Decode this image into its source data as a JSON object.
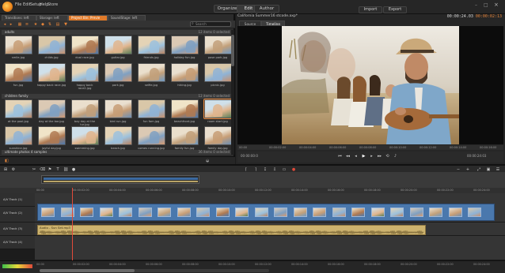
{
  "menu": [
    "File",
    "Edit",
    "Setup",
    "Help",
    "Store"
  ],
  "modes": {
    "organize": "Organize",
    "edit": "Edit",
    "author": "Author"
  },
  "io": {
    "import": "Import",
    "export": "Export"
  },
  "library": {
    "tabs": [
      "Transitions: Ieft",
      "Storage: left",
      "Project Bin: Previe",
      "SoundStage: Ieft"
    ],
    "search_placeholder": "Search",
    "sections": [
      {
        "title": "adults",
        "count": "12 items 0 selected"
      },
      {
        "title": "children family",
        "count": "12 items 0 selected"
      },
      {
        "title": "ultimate photos 4 samples",
        "count": "36 items 0 selected"
      }
    ],
    "row1": [
      "smile.jpg",
      "childs.jpg",
      "dual race.jpg",
      "guitar.jpg",
      "friends.jpg",
      "holiday fun.jpg",
      "pose park.jpg"
    ],
    "row2": [
      "fun.jpg",
      "happy back race.jpg",
      "happy back race2.jpg",
      "park.jpg",
      "selfie.jpg",
      "hiking.jpg",
      "picnic.jpg"
    ],
    "row3": [
      "at the pool.jpg",
      "day at the bar.jpg",
      "boy day at the tur.jpg",
      "bird run.jpg",
      "fun fam.jpg",
      "beachfront.jpg",
      "room start.jpg"
    ],
    "row4": [
      "sunshine.jpg",
      "joyful day.jpg",
      "swimming.jpg",
      "beach.jpg",
      "comes running.jpg",
      "family fun.jpg",
      "family day.jpg"
    ]
  },
  "player": {
    "title": "California Summer16 stcode.axp*",
    "timecode": "00:00:24.03",
    "timecode2": "00:00:02:13",
    "tabs": {
      "source": "Source",
      "timeline": "Timeline"
    },
    "ruler": [
      "00:00",
      "00:00:02:00",
      "00:00:04:00",
      "00:00:06:00",
      "00:00:08:00",
      "00:00:10:00",
      "00:00:12:00",
      "00:00:14:00",
      "00:00:16:00"
    ],
    "tc_left": "00:00:00:0",
    "tc_right": "00:00:24:03"
  },
  "timeline": {
    "tracks": [
      "A/V Track (1)",
      "A/V Track (2)",
      "A/V Track (3)",
      "A/V Track (4)"
    ],
    "audio_clip_label": "Audio - Sun Set.mp3",
    "ruler": [
      "00:00",
      "00:00:02:00",
      "00:00:04:00",
      "00:00:06:00",
      "00:00:08:00",
      "00:00:10:00",
      "00:00:12:00",
      "00:00:14:00",
      "00:00:16:00",
      "00:00:18:00",
      "00:00:20:00",
      "00:00:22:00",
      "00:00:24:00"
    ]
  },
  "colors": {
    "accent": "#e8863a",
    "clip_video": "#4a78ad",
    "clip_audio": "#cdb36e",
    "playhead": "#e04a3a"
  }
}
